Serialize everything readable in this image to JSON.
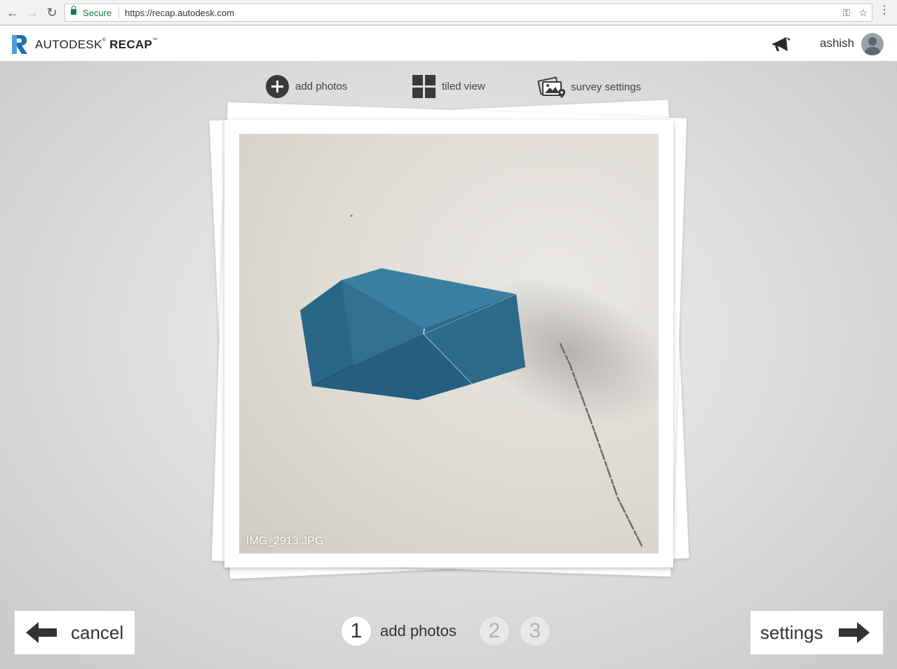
{
  "browser": {
    "secure_label": "Secure",
    "url": "https://recap.autodesk.com",
    "icons": [
      "back-arrow-icon",
      "forward-arrow-icon",
      "reload-icon",
      "lock-icon",
      "key-icon",
      "star-icon",
      "more-vert-icon"
    ]
  },
  "header": {
    "brand_light": "AUTODESK",
    "brand_bold": "RECAP",
    "username": "ashish",
    "brand_color": "#1c6fb6"
  },
  "toolbar": {
    "add_photos": "add photos",
    "tiled_view": "tiled view",
    "survey_settings": "survey settings"
  },
  "photo": {
    "filename": "IMG_2913.JPG"
  },
  "footer": {
    "cancel": "cancel",
    "settings": "settings",
    "steps": [
      {
        "number": "1",
        "label": "add photos",
        "active": true
      },
      {
        "number": "2",
        "active": false
      },
      {
        "number": "3",
        "active": false
      }
    ]
  }
}
